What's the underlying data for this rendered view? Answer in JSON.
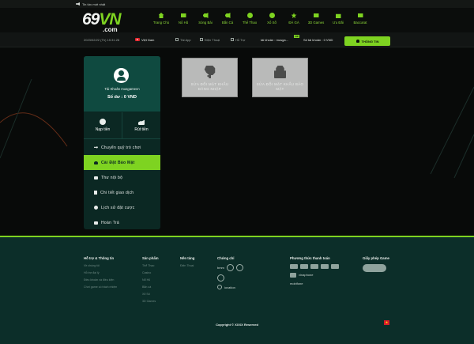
{
  "topbar": {
    "notice": "Tin tức mới nhất"
  },
  "logo": {
    "main": "69",
    "accent": "VN",
    "domain": ".com"
  },
  "nav": [
    {
      "label": "Trang Chủ",
      "icon": "home-icon"
    },
    {
      "label": "Nổ Hũ",
      "icon": "slot-icon"
    },
    {
      "label": "Sòng Bài",
      "icon": "casino-icon"
    },
    {
      "label": "Bắn Cá",
      "icon": "fish-icon"
    },
    {
      "label": "Thể Thao",
      "icon": "ball-icon"
    },
    {
      "label": "Xổ Số",
      "icon": "lottery-icon"
    },
    {
      "label": "ĐÁ GÀ",
      "icon": "rooster-icon"
    },
    {
      "label": "3D Games",
      "icon": "game-icon"
    },
    {
      "label": "Ưu Đãi",
      "icon": "gift-icon"
    },
    {
      "label": "Baccarat",
      "icon": "card-icon"
    }
  ],
  "subbar": {
    "datetime": "2023/02/22 (Th) 15:31:28",
    "youtube": "Việt Nam",
    "app": "Tải App",
    "phone": "Điện Thoại",
    "support": "Hỗ Trợ",
    "account": "tài khoản : musga...",
    "vip": "VIP",
    "balance": "Số tài khoản : 0 VND",
    "info_button": "THÔNG TIN"
  },
  "colors": {
    "accent": "#7ed321",
    "panel": "#0b2823",
    "panel_header": "#0f4a40",
    "footer": "#0c2e29"
  },
  "sidebar": {
    "account_label": "Tài Khoản musgamevn",
    "balance_label": "Số dư : 0 VND",
    "deposit": "Nạp tiền",
    "withdraw": "Rút tiền",
    "menu": [
      {
        "label": "Chuyển quỹ trò chơi",
        "icon": "transfer-icon"
      },
      {
        "label": "Cài Đặt Bảo Mật",
        "icon": "security-users-icon"
      },
      {
        "label": "Thư nội bộ",
        "icon": "mail-icon"
      },
      {
        "label": "Chi tiết giao dịch",
        "icon": "transaction-icon"
      },
      {
        "label": "Lịch sử đặt cược",
        "icon": "history-icon"
      },
      {
        "label": "Hoàn Trả",
        "icon": "refund-icon"
      }
    ]
  },
  "cards": [
    {
      "label": "SỬA ĐỔI MẬT KHẨU ĐĂNG NHẬP",
      "icon": "key-icon"
    },
    {
      "label": "SỬA ĐỔI MẬT KHẨU BẢO MẬT",
      "icon": "lock-icon"
    }
  ],
  "footer": {
    "col1": {
      "title": "Hỗ trợ & Thông tin",
      "links": [
        "Về chúng tôi",
        "Hỗ trợ đại lý",
        "Điều khoản và điều kiện",
        "Chơi game có trách nhiệm"
      ]
    },
    "col2": {
      "title": "Sản phẩm",
      "links": [
        "Thể Thao",
        "Casino",
        "Nổ Hũ",
        "Bắn cá",
        "Xổ Số",
        "3D Games"
      ]
    },
    "col3": {
      "title": "Nền tảng",
      "links": [
        "Điện Thoại"
      ]
    },
    "col4": {
      "title": "Chứng chỉ",
      "logos": [
        "bmm",
        "iovation"
      ]
    },
    "col5": {
      "title": "Phương thức thanh toán",
      "logos": [
        "vinaphone",
        "mobifone"
      ]
    },
    "col6": {
      "title": "Giấy phép Game"
    },
    "copyright": "Copyright © XXXX Reserved"
  }
}
